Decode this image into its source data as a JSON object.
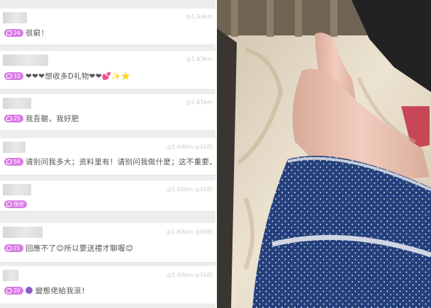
{
  "feed": {
    "items": [
      {
        "count": "24",
        "message": "很窮！",
        "meta": "◎1.63km"
      },
      {
        "count": "33",
        "message": "❤❤❤想收多D礼物❤❤💕✨⭐",
        "meta": "◎1.63km"
      },
      {
        "count": "25",
        "message": "我吾靚，我好肥",
        "meta": "◎1.61km"
      },
      {
        "count": "56",
        "message": "请别问我多大；资料里有！请别问我做什麼；这不重要。",
        "meta": "◎1.64km ◎10的"
      },
      {
        "count": "保密",
        "message": "",
        "meta": "◎1.65km ◎16的"
      },
      {
        "count": "21",
        "message": "回應不了😊所以要送禮才聊喔😊",
        "meta": "◎1.63km ◎16的"
      },
      {
        "count": "20",
        "message": "變態佬給我滾！",
        "meta": "◎1.60km ◎16的"
      }
    ]
  },
  "photo": {
    "subject": "legs-on-bed-photo",
    "colors": {
      "dress": "#23407f",
      "sheet": "#e9ddc8",
      "skin": "#e9bfae",
      "dark": "#1a1a1a"
    }
  }
}
